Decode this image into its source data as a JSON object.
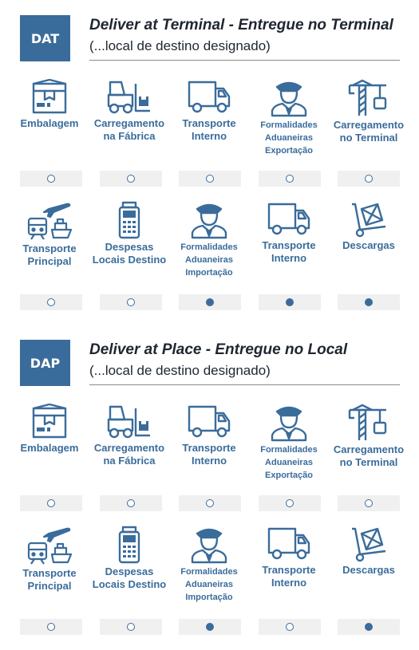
{
  "sections": [
    {
      "badge": "DAT",
      "title": "Deliver at Terminal - Entregue no Terminal",
      "subtitle": "(...local de destino designado)",
      "row1": [
        {
          "label": "Embalagem",
          "icon": "package-icon",
          "active": false
        },
        {
          "label": "Carregamento na Fábrica",
          "icon": "forklift-icon",
          "active": false
        },
        {
          "label": "Transporte Interno",
          "icon": "truck-icon",
          "active": false
        },
        {
          "label": "Formalidades Aduaneiras Exportação",
          "icon": "customs-officer-icon",
          "active": false
        },
        {
          "label": "Carregamento no Terminal",
          "icon": "crane-icon",
          "active": false
        }
      ],
      "row2": [
        {
          "label": "Transporte Principal",
          "icon": "main-transport-icon",
          "active": false
        },
        {
          "label": "Despesas Locais Destino",
          "icon": "pos-terminal-icon",
          "active": false
        },
        {
          "label": "Formalidades Aduaneiras Importação",
          "icon": "customs-officer-icon",
          "active": true
        },
        {
          "label": "Transporte Interno",
          "icon": "truck-icon",
          "active": true
        },
        {
          "label": "Descargas",
          "icon": "hand-truck-icon",
          "active": true
        }
      ]
    },
    {
      "badge": "DAP",
      "title": "Deliver at Place - Entregue no Local",
      "subtitle": "(...local de destino designado)",
      "row1": [
        {
          "label": "Embalagem",
          "icon": "package-icon",
          "active": false
        },
        {
          "label": "Carregamento na Fábrica",
          "icon": "forklift-icon",
          "active": false
        },
        {
          "label": "Transporte Interno",
          "icon": "truck-icon",
          "active": false
        },
        {
          "label": "Formalidades Aduaneiras Exportação",
          "icon": "customs-officer-icon",
          "active": false
        },
        {
          "label": "Carregamento no Terminal",
          "icon": "crane-icon",
          "active": false
        }
      ],
      "row2": [
        {
          "label": "Transporte Principal",
          "icon": "main-transport-icon",
          "active": false
        },
        {
          "label": "Despesas Locais Destino",
          "icon": "pos-terminal-icon",
          "active": false
        },
        {
          "label": "Formalidades Aduaneiras Importação",
          "icon": "customs-officer-icon",
          "active": true
        },
        {
          "label": "Transporte Interno",
          "icon": "truck-icon",
          "active": false
        },
        {
          "label": "Descargas",
          "icon": "hand-truck-icon",
          "active": true
        }
      ]
    }
  ],
  "colors": {
    "accent": "#3a6c9b",
    "indicator_bg": "#f0f0f0",
    "title": "#1f2630"
  }
}
